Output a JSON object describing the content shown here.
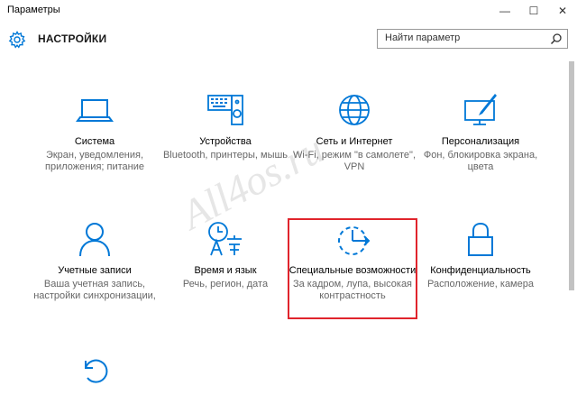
{
  "window": {
    "title": "Параметры",
    "minimize_glyph": "—",
    "maximize_glyph": "☐",
    "close_glyph": "✕"
  },
  "header": {
    "title": "НАСТРОЙКИ",
    "icon": "gear-icon"
  },
  "search": {
    "placeholder": "Найти параметр",
    "icon": "search-icon"
  },
  "accent_color": "#0078d7",
  "highlight_color": "#e0242c",
  "watermark": "All4os.ru",
  "tiles": [
    {
      "title": "Система",
      "desc": "Экран, уведомления, приложения; питание",
      "icon": "laptop-icon"
    },
    {
      "title": "Устройства",
      "desc": "Bluetooth, принтеры, мышь",
      "icon": "keyboard-speaker-icon"
    },
    {
      "title": "Сеть и Интернет",
      "desc": "Wi-Fi, режим \"в самолете\", VPN",
      "icon": "globe-icon"
    },
    {
      "title": "Персонализация",
      "desc": "Фон, блокировка экрана, цвета",
      "icon": "paint-monitor-icon"
    },
    {
      "title": "Учетные записи",
      "desc": "Ваша учетная запись, настройки синхронизации,",
      "icon": "person-icon"
    },
    {
      "title": "Время и язык",
      "desc": "Речь, регион, дата",
      "icon": "time-language-icon"
    },
    {
      "title": "Специальные возможности",
      "desc": "За кадром, лупа, высокая контрастность",
      "icon": "ease-of-access-icon"
    },
    {
      "title": "Конфиденциальность",
      "desc": "Расположение, камера",
      "icon": "lock-icon"
    },
    {
      "title": "",
      "desc": "",
      "icon": "update-refresh-icon"
    }
  ]
}
